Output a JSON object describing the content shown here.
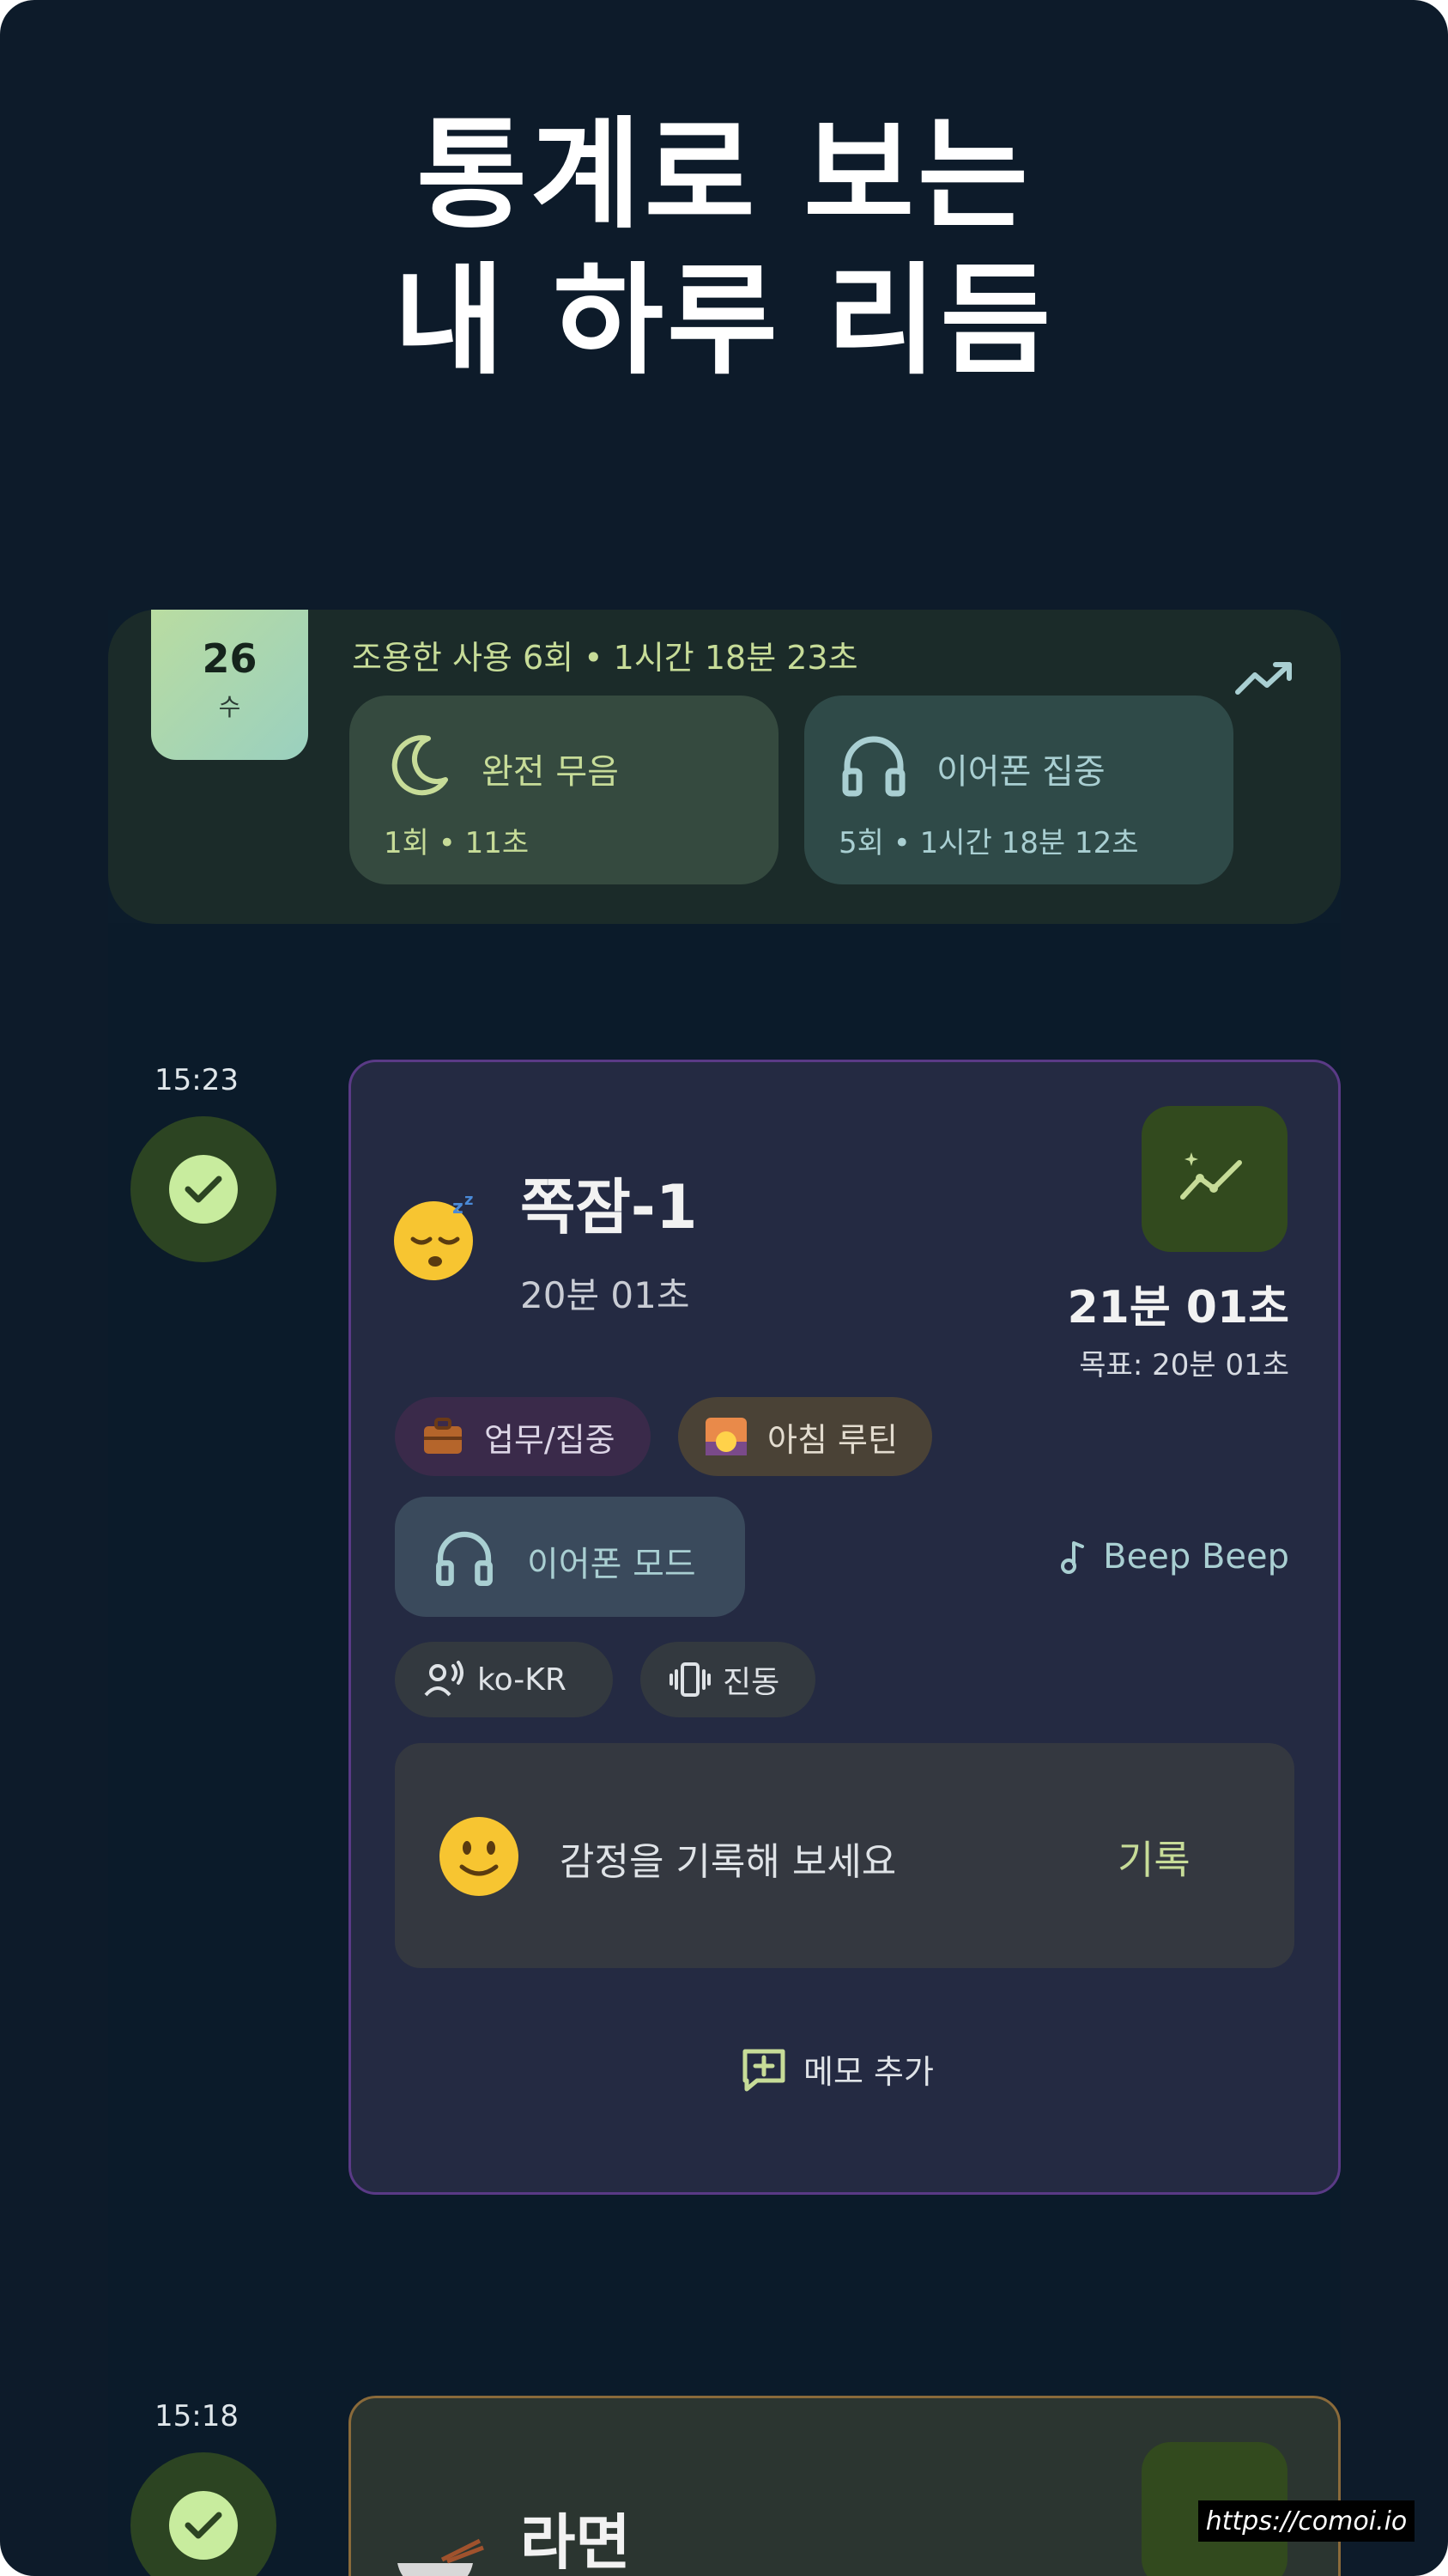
{
  "headline": {
    "line1": "통계로 보는",
    "line2": "내 하루 리듬"
  },
  "summary": {
    "date_day": "26",
    "date_weekday": "수",
    "usage_line": "조용한 사용 6회 • 1시간 18분 23초",
    "silent_title": "완전 무음",
    "silent_sub": "1회 • 11초",
    "ear_title": "이어폰 집중",
    "ear_sub": "5회 • 1시간 18분 12초"
  },
  "entries": [
    {
      "time": "15:23",
      "title": "쪽잠-1",
      "duration": "20분 01초",
      "actual": "21분 01초",
      "goal": "목표: 20분 01초",
      "chips": [
        "업무/집중",
        "아침 루틴"
      ],
      "mode": "이어폰 모드",
      "sound": "Beep Beep",
      "language": "ko-KR",
      "vibration": "진동",
      "emotion_prompt": "감정을 기록해 보세요",
      "emotion_action": "기록",
      "memo_action": "메모 추가"
    },
    {
      "time": "15:18",
      "title": "라면"
    }
  ],
  "watermark": "https://comoi.io",
  "colors": {
    "background": "#0d1b2a",
    "accent_green": "#c7dc98",
    "accent_teal": "#a9cfd2",
    "card_border_purple": "#5a3a86",
    "card_border_gold": "#8a6a3a"
  }
}
